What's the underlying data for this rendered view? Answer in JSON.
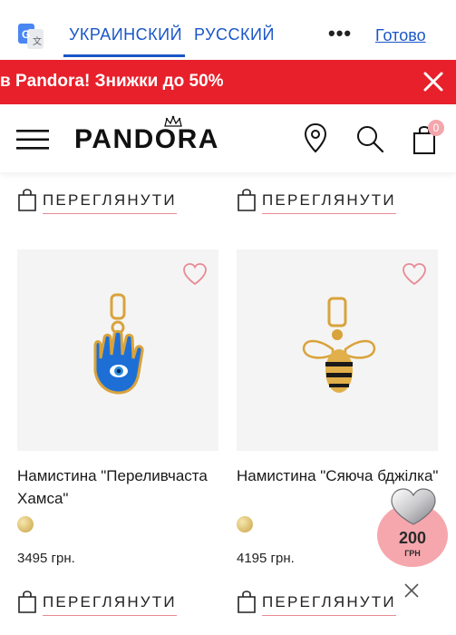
{
  "translate_bar": {
    "active_language": "УКРАИНСКИЙ",
    "other_language": "РУССКИЙ",
    "menu_icon": "more-dots-icon",
    "done_label": "Готово"
  },
  "promo_banner": {
    "text": "в Pandora! Знижки до 50%",
    "background": "#e8202b"
  },
  "header": {
    "brand": "PANDORA",
    "cart_count": "0",
    "icons": [
      "menu-icon",
      "location-pin-icon",
      "search-icon",
      "shopping-bag-icon"
    ]
  },
  "view_button_label": "ПЕРЕГЛЯНУТИ",
  "products": [
    {
      "name": "Намистина \"Переливчаста Хамса\"",
      "price": "3495 грн."
    },
    {
      "name": "Намистина \"Сяюча бджілка\"",
      "price": "4195 грн."
    }
  ],
  "promo_widget": {
    "amount": "200",
    "currency": "ГРН"
  },
  "colors": {
    "accent_blue": "#1a56c7",
    "banner_red": "#e8202b",
    "link_underline": "#e88a95",
    "badge_pink": "#f6a7ad"
  }
}
